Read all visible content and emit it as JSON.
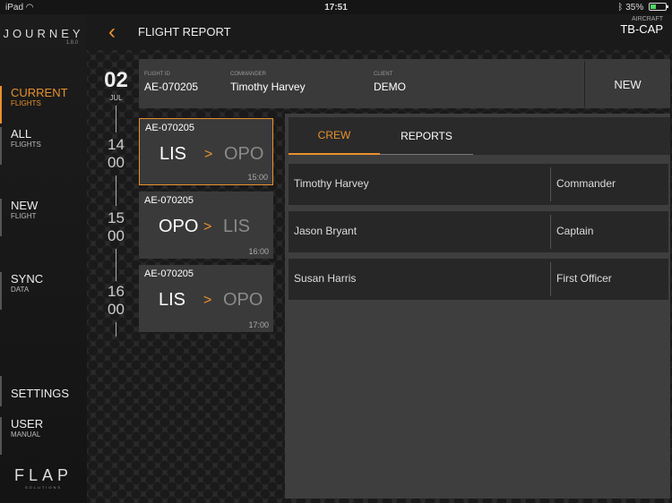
{
  "status": {
    "device": "iPad",
    "time": "17:51",
    "battery": "35%"
  },
  "app": {
    "name": "JOURNEY",
    "version": "1.8.0",
    "company": "FLAP",
    "company_sub": "SOLUTIONS"
  },
  "nav": [
    {
      "big": "CURRENT",
      "small": "FLIGHTS"
    },
    {
      "big": "ALL",
      "small": "FLIGHTS"
    },
    {
      "big": "NEW",
      "small": "FLIGHT"
    },
    {
      "big": "SYNC",
      "small": "DATA"
    },
    {
      "big": "SETTINGS",
      "small": ""
    },
    {
      "big": "USER",
      "small": "MANUAL"
    }
  ],
  "header": {
    "back": "‹",
    "title": "FLIGHT REPORT",
    "aircraft_label": "AIRCRAFT",
    "aircraft_value": "TB-CAP"
  },
  "date": {
    "day": "02",
    "month": "JUL"
  },
  "hours": [
    {
      "h": "14",
      "m": "00"
    },
    {
      "h": "15",
      "m": "00"
    },
    {
      "h": "16",
      "m": "00"
    }
  ],
  "info": {
    "flight_id_label": "FLIGHT ID",
    "flight_id": "AE-070205",
    "commander_label": "COMMANDER",
    "commander": "Timothy Harvey",
    "client_label": "CLIENT",
    "client": "DEMO",
    "new_label": "NEW"
  },
  "flights": [
    {
      "id": "AE-070205",
      "from": "LIS",
      "arrow": ">",
      "to": "OPO",
      "time": "15:00"
    },
    {
      "id": "AE-070205",
      "from": "OPO",
      "arrow": ">",
      "to": "LIS",
      "time": "16:00"
    },
    {
      "id": "AE-070205",
      "from": "LIS",
      "arrow": ">",
      "to": "OPO",
      "time": "17:00"
    }
  ],
  "tabs": {
    "crew": "CREW",
    "reports": "REPORTS"
  },
  "crew": [
    {
      "name": "Timothy Harvey",
      "role": "Commander"
    },
    {
      "name": "Jason Bryant",
      "role": "Captain"
    },
    {
      "name": "Susan Harris",
      "role": "First Officer"
    }
  ],
  "colors": {
    "accent": "#e8912d"
  }
}
